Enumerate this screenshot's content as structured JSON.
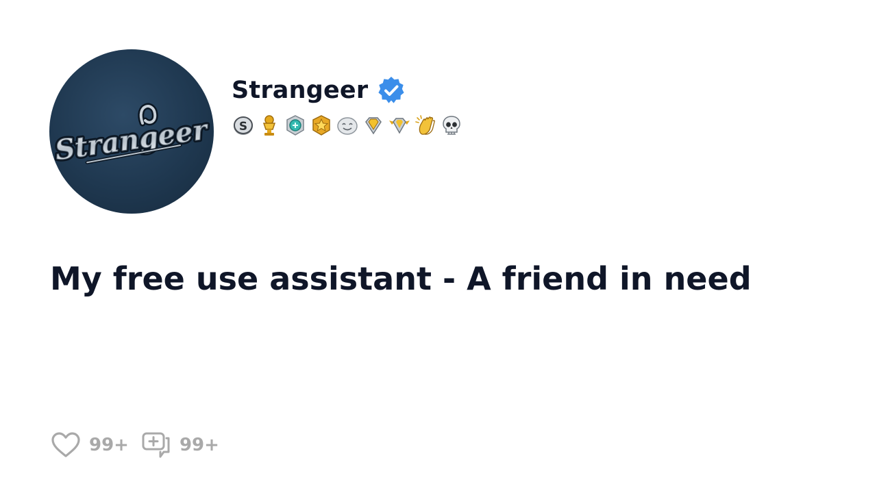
{
  "avatar": {
    "logo_text": "Strangeer",
    "background_color": "#1f3850"
  },
  "profile": {
    "username": "Strangeer",
    "verified": true,
    "verified_color": "#3b8eea",
    "badges": [
      {
        "icon": "s-coin-badge-icon"
      },
      {
        "icon": "gold-trophy-badge-icon"
      },
      {
        "icon": "teal-gem-badge-icon"
      },
      {
        "icon": "gold-star-badge-icon"
      },
      {
        "icon": "silver-smile-badge-icon"
      },
      {
        "icon": "gold-diamond-badge-icon"
      },
      {
        "icon": "winged-diamond-badge-icon"
      },
      {
        "icon": "clapping-hands-badge-icon"
      },
      {
        "icon": "skull-badge-icon"
      }
    ]
  },
  "post": {
    "title": "My free use assistant - A friend in need"
  },
  "stats": {
    "likes": "99+",
    "comments": "99+",
    "muted_color": "#a9a9a9"
  }
}
